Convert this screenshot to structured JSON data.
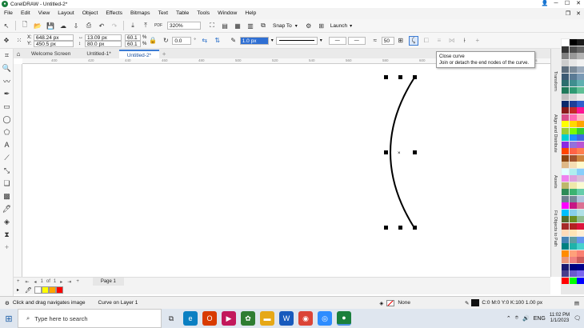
{
  "window": {
    "title": "CorelDRAW - Untitled-2*"
  },
  "menubar": {
    "items": [
      "File",
      "Edit",
      "View",
      "Layout",
      "Object",
      "Effects",
      "Bitmaps",
      "Text",
      "Table",
      "Tools",
      "Window",
      "Help"
    ]
  },
  "toolbar1": {
    "zoom": "320%",
    "snap_to": "Snap To",
    "launch": "Launch"
  },
  "toolbar2": {
    "x_label": "X:",
    "x_value": "648.24 px",
    "y_label": "Y:",
    "y_value": "450.5 px",
    "w_value": "13.09 px",
    "h_value": "80.0 px",
    "scale_x": "60.1",
    "scale_y": "60.1",
    "pct": "%",
    "angle": "0.0",
    "outline_width": "1.0 px",
    "smooth": "50"
  },
  "tabs": [
    "Welcome Screen",
    "Untitled-1*",
    "Untitled-2*"
  ],
  "ruler": {
    "ticks": [
      "400",
      "420",
      "440",
      "460",
      "480",
      "500",
      "520",
      "540",
      "560",
      "580",
      "600",
      "620",
      "640",
      "660",
      "680",
      "700"
    ],
    "unit": "pixels"
  },
  "tooltip": {
    "title": "Close curve",
    "body": "Join or detach the end nodes of the curve."
  },
  "dock": {
    "tabs": [
      "Transform",
      "Align and Distribute",
      "Assets",
      "Fit Objects to Path"
    ]
  },
  "pagenav": {
    "current": "1",
    "of": "of",
    "total": "1",
    "page_tab": "Page 1"
  },
  "status": {
    "hint": "Click and drag navigates image",
    "selection": "Curve on Layer 1",
    "fill": "None",
    "outline": "C:0 M:0 Y:0 K:100  1.00 px"
  },
  "taskbar": {
    "search_placeholder": "Type here to search",
    "time": "11:02 PM",
    "date": "1/1/2023",
    "lang": "ENG"
  },
  "palette_colors": [
    "#ffffff",
    "#000000",
    "#1a1a1a",
    "#333333",
    "#4d4d4d",
    "#666666",
    "#808080",
    "#999999",
    "#b3b3b3",
    "#cccccc",
    "#e6e6e6",
    "#f2f2f2",
    "#5b6b7a",
    "#7a8a99",
    "#9aaabb",
    "#3c5a73",
    "#5a7a95",
    "#7a9ab5",
    "#2d6e6e",
    "#3f8f8f",
    "#5fb0b0",
    "#1f7a5a",
    "#2f9a73",
    "#5fbf95",
    "#c0c0c0",
    "#d8d8d8",
    "#ececec",
    "#0b2a6b",
    "#1e3f99",
    "#2f5fcc",
    "#8b1a1a",
    "#c62828",
    "#ff1493",
    "#d94f8a",
    "#ff69b4",
    "#ffb6c1",
    "#ffff00",
    "#ffd700",
    "#ffa500",
    "#9acd32",
    "#7cfc00",
    "#32cd32",
    "#00ced1",
    "#1e90ff",
    "#4169e1",
    "#8a2be2",
    "#9370db",
    "#ba55d3",
    "#ff4500",
    "#ff6347",
    "#ff7f50",
    "#8b4513",
    "#a0522d",
    "#cd853f",
    "#deb887",
    "#f5deb3",
    "#fffacd",
    "#e0ffff",
    "#afeeee",
    "#87cefa",
    "#ee82ee",
    "#dda0dd",
    "#d8bfd8",
    "#bdb76b",
    "#eee8aa",
    "#fafad2",
    "#2e8b57",
    "#3cb371",
    "#66cdaa",
    "#708090",
    "#778899",
    "#b0c4de",
    "#ff00ff",
    "#c71585",
    "#db7093",
    "#00bfff",
    "#87ceeb",
    "#b0e0e6",
    "#556b2f",
    "#6b8e23",
    "#8fbc8f",
    "#a52a2a",
    "#b22222",
    "#dc143c",
    "#ffdab9",
    "#ffe4b5",
    "#ffefd5",
    "#4682b4",
    "#5f9ea0",
    "#6495ed",
    "#008080",
    "#20b2aa",
    "#48d1cc",
    "#ff8c00",
    "#ffa07a",
    "#fa8072",
    "#e9967a",
    "#f08080",
    "#cd5c5c",
    "#191970",
    "#000080",
    "#00008b",
    "#483d8b",
    "#6a5acd",
    "#7b68ee",
    "#ff0000",
    "#00ff00",
    "#0000ff"
  ],
  "doc_palette": [
    "#ffffff",
    "#ffff00",
    "#ffa500",
    "#ff0000"
  ],
  "accent": "#3b7bd4"
}
